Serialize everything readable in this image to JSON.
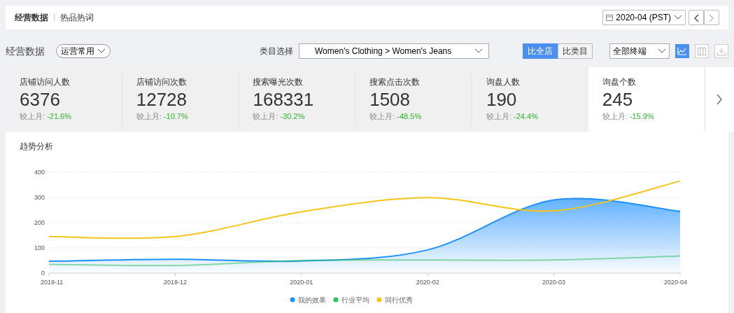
{
  "tabs": [
    {
      "label": "经营数据",
      "selected": true
    },
    {
      "label": "热品热词",
      "selected": false
    }
  ],
  "date_picker": {
    "value": "2020-04 (PST)"
  },
  "filters": {
    "title": "经营数据",
    "preset": "运营常用",
    "category_label": "类目选择",
    "category": "Women's Clothing > Women's Jeans",
    "compare": [
      {
        "label": "比全店",
        "selected": true
      },
      {
        "label": "比类目",
        "selected": false
      }
    ],
    "terminal": "全部终端",
    "views": [
      {
        "kind": "line",
        "selected": true
      },
      {
        "kind": "table",
        "selected": false
      }
    ]
  },
  "kpis": [
    {
      "label": "店铺访问人数",
      "value": "6376",
      "change_label": "较上月:",
      "change": "-21.6%",
      "selected": false
    },
    {
      "label": "店铺访问次数",
      "value": "12728",
      "change_label": "较上月:",
      "change": "-10.7%",
      "selected": false
    },
    {
      "label": "搜索曝光次数",
      "value": "168331",
      "change_label": "较上月:",
      "change": "-30.2%",
      "selected": false
    },
    {
      "label": "搜索点击次数",
      "value": "1508",
      "change_label": "较上月:",
      "change": "-48.5%",
      "selected": false
    },
    {
      "label": "询盘人数",
      "value": "190",
      "change_label": "较上月:",
      "change": "-24.4%",
      "selected": false
    },
    {
      "label": "询盘个数",
      "value": "245",
      "change_label": "较上月:",
      "change": "-15.9%",
      "selected": true
    }
  ],
  "trend": {
    "title": "趋势分析",
    "chart_data": {
      "type": "line",
      "grid": true,
      "legend": "bottom",
      "categories": [
        "2019-11",
        "2019-12",
        "2020-01",
        "2020-02",
        "2020-03",
        "2020-04"
      ],
      "ylim": [
        0,
        400
      ],
      "yticks": [
        0,
        100,
        200,
        300,
        400
      ],
      "series": [
        {
          "name": "我的效果",
          "color": "#1e90ff",
          "type": "area",
          "values": [
            47,
            55,
            48,
            92,
            290,
            245
          ]
        },
        {
          "name": "行业平均",
          "color": "#2ec25b",
          "type": "line",
          "values": [
            35,
            30,
            50,
            52,
            52,
            68
          ]
        },
        {
          "name": "同行优秀",
          "color": "#f5c518",
          "type": "line",
          "values": [
            145,
            145,
            243,
            299,
            247,
            365
          ]
        }
      ]
    }
  }
}
